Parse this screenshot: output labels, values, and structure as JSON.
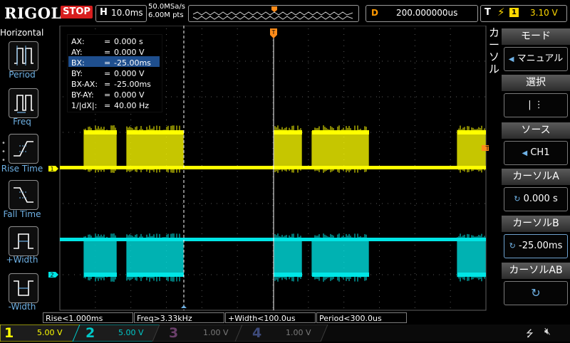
{
  "header": {
    "logo": "RIGOL",
    "run_state": "STOP",
    "timebase_label": "H",
    "timebase": "10.0ms",
    "sample_rate": "50.0MSa/s",
    "memory_depth": "6.00M pts",
    "delay_label": "D",
    "delay": "200.000000us",
    "trigger_label": "T",
    "trigger_source": "1",
    "trigger_level": "3.10 V"
  },
  "horizontal_menu": {
    "title": "Horizontal",
    "items": [
      {
        "label": "Period",
        "icon": "period-icon"
      },
      {
        "label": "Freq",
        "icon": "freq-icon"
      },
      {
        "label": "Rise Time",
        "icon": "rise-time-icon"
      },
      {
        "label": "Fall Time",
        "icon": "fall-time-icon"
      },
      {
        "label": "+Width",
        "icon": "positive-width-icon"
      },
      {
        "label": "-Width",
        "icon": "negative-width-icon"
      }
    ]
  },
  "cursor_readout": {
    "rows": [
      {
        "key": "AX:",
        "value": "0.000 s"
      },
      {
        "key": "AY:",
        "value": "0.000 V"
      },
      {
        "key": "BX:",
        "value": "-25.00ms"
      },
      {
        "key": "BY:",
        "value": "0.000 V"
      },
      {
        "key": "BX-AX:",
        "value": "-25.00ms"
      },
      {
        "key": "BY-AY:",
        "value": "0.000 V"
      },
      {
        "key": "1/|dX|:",
        "value": "40.00 Hz"
      }
    ],
    "eq": "="
  },
  "cursor_menu": {
    "vertical_title": "カーソル",
    "mode_label": "モード",
    "mode_value": "マニュアル",
    "select_label": "選択",
    "select_value": "|  ⋮",
    "source_label": "ソース",
    "source_value": "CH1",
    "cursor_a_label": "カーソルA",
    "cursor_a_value": "0.000 s",
    "cursor_b_label": "カーソルB",
    "cursor_b_value": "-25.00ms",
    "cursor_ab_label": "カーソルAB"
  },
  "measurements": [
    "Rise<1.000ms",
    "Freq>3.33kHz",
    "+Width<100.0us",
    "Period<300.0us"
  ],
  "channels": [
    {
      "num": "1",
      "scale": "5.00 V",
      "color": "#ffff00",
      "active": true
    },
    {
      "num": "2",
      "scale": "5.00 V",
      "color": "#00e5e5",
      "active": true
    },
    {
      "num": "3",
      "scale": "1.00 V",
      "color": "#e040e0",
      "active": false
    },
    {
      "num": "4",
      "scale": "1.00 V",
      "color": "#4a7cff",
      "active": false
    }
  ],
  "waveform": {
    "ch1_marker": "1",
    "ch2_marker": "2",
    "trigger_marker": "T",
    "top_trigger_marker": "T",
    "colors": {
      "ch1": "#ffff00",
      "ch2": "#00e5e5",
      "grid": "#3a3a3a",
      "trigger": "#ff8c1a"
    }
  },
  "status_icons": [
    "usb-icon",
    "speaker-muted-icon"
  ]
}
